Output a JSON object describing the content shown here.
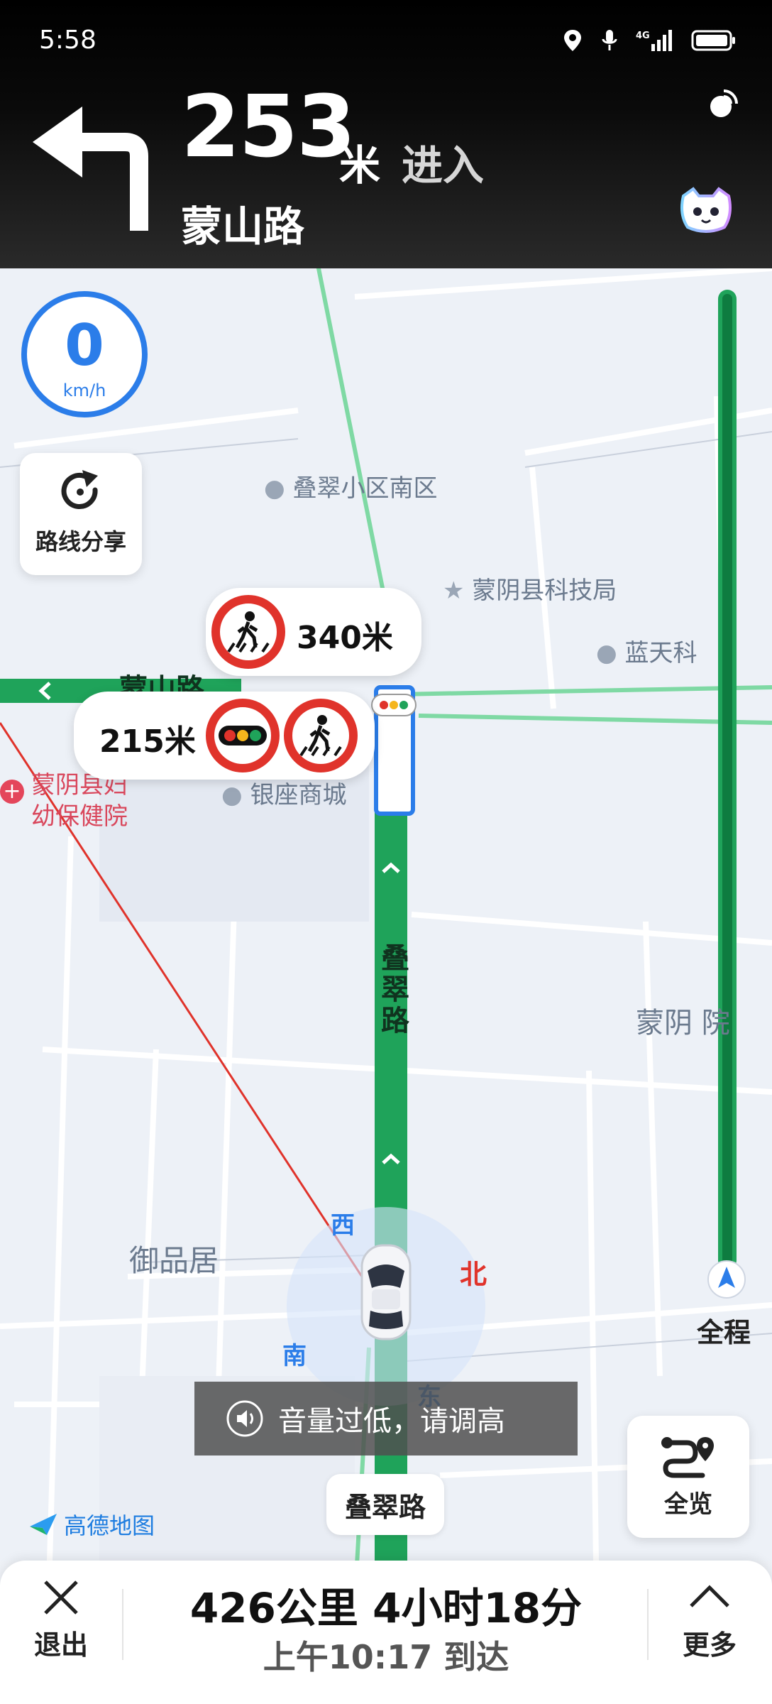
{
  "status_bar": {
    "time": "5:58",
    "icons": [
      "location-icon",
      "mic-icon",
      "4g-signal-icon",
      "battery-icon"
    ]
  },
  "nav": {
    "distance": "253",
    "unit": "米",
    "action": "进入",
    "road": "蒙山路"
  },
  "speed": {
    "value": "0",
    "unit": "km/h"
  },
  "share": {
    "label": "路线分享"
  },
  "pois": {
    "p1": "叠翠小区南区",
    "p2": "蒙阴县科技局",
    "p3": "蓝天科",
    "p4": "蒙阴县妇",
    "p4b": "幼保健院",
    "p5": "银座商城",
    "p6": "蒙阴",
    "p6b": "院",
    "p7": "御品居",
    "p8": "蒙山路"
  },
  "alerts": {
    "upper": {
      "distance": "340米"
    },
    "lower": {
      "distance": "215米"
    }
  },
  "route": {
    "road_label": "叠翠路"
  },
  "compass": {
    "west": "西",
    "north": "北",
    "south": "南",
    "east": "东"
  },
  "overview_side": {
    "label": "全程"
  },
  "toast": {
    "text": "音量过低，请调高"
  },
  "full_view": {
    "label": "全览"
  },
  "current_road": "叠翠路",
  "brand": "高德地图",
  "bottom": {
    "exit_label": "退出",
    "summary": "426公里 4小时18分",
    "eta": "上午10:17 到达",
    "more_label": "更多"
  },
  "colors": {
    "route_green": "#1fa35a",
    "accent_blue": "#2b7de9",
    "alert_red": "#e0332b"
  }
}
